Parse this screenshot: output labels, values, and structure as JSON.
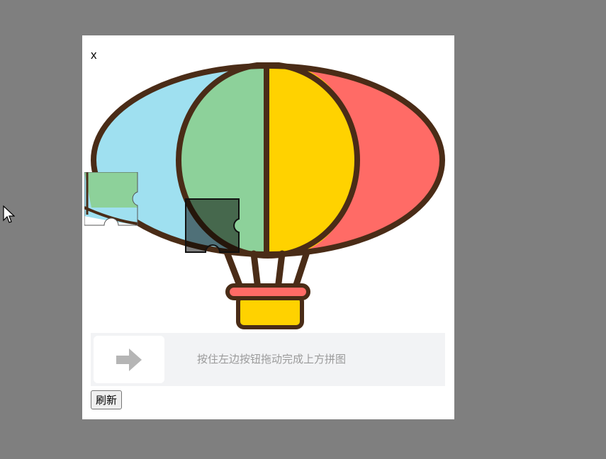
{
  "dialog": {
    "close_label": "x"
  },
  "puzzle": {
    "image": "hot-air-balloon",
    "piece_shape": "jigsaw-piece",
    "colors": {
      "outline": "#4a2c17",
      "blue": "#9fe0f0",
      "green": "#8dd19a",
      "yellow": "#ffd200",
      "red": "#ff6b66"
    }
  },
  "slider": {
    "handle_icon": "right-arrow-icon",
    "hint": "按住左边按钮拖动完成上方拼图"
  },
  "refresh": {
    "label": "刷新"
  }
}
